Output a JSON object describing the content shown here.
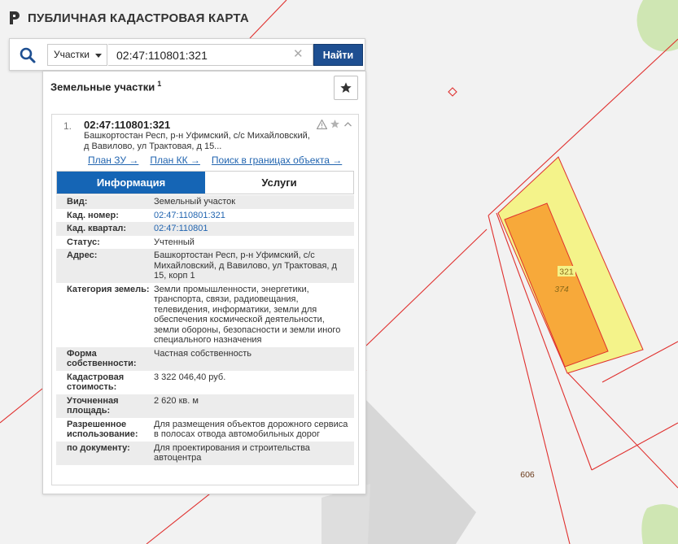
{
  "app": {
    "title": "ПУБЛИЧНАЯ КАДАСТРОВАЯ КАРТА"
  },
  "search": {
    "type_label": "Участки",
    "value": "02:47:110801:321",
    "button_label": "Найти"
  },
  "panel": {
    "title": "Земельные участки",
    "count": "1",
    "result": {
      "index": "1.",
      "number": "02:47:110801:321",
      "address": "Башкортостан Респ, р-н Уфимский, с/с Михайловский, д Вавилово, ул Трактовая, д 15...",
      "links": [
        "План ЗУ →",
        "План КК →",
        "Поиск в границах объекта →"
      ]
    },
    "tabs": [
      "Информация",
      "Услуги"
    ],
    "info": [
      {
        "label": "Вид:",
        "value": "Земельный участок"
      },
      {
        "label": "Кад. номер:",
        "value": "02:47:110801:321"
      },
      {
        "label": "Кад. квартал:",
        "value": "02:47:110801"
      },
      {
        "label": "Статус:",
        "value": "Учтенный"
      },
      {
        "label": "Адрес:",
        "value": "Башкортостан Респ, р-н Уфимский, с/с Михайловский, д Вавилово, ул Трактовая, д 15, корп 1"
      },
      {
        "label": "Категория земель:",
        "value": "Земли промышленности, энергетики, транспорта, связи, радиовещания, телевидения, информатики, земли для обеспечения космической деятельности, земли обороны, безопасности и земли иного специального назначения"
      },
      {
        "label": "Форма собственности:",
        "value": "Частная собственность"
      },
      {
        "label": "Кадастровая стоимость:",
        "value": "3 322 046,40 руб."
      },
      {
        "label": "Уточненная площадь:",
        "value": "2 620 кв. м"
      },
      {
        "label": "Разрешенное использование:",
        "value": "Для размещения объектов дорожного сервиса в полосах отвода автомобильных дорог"
      },
      {
        "label": "по документу:",
        "value": "Для проектирования и строительства автоцентра"
      }
    ]
  },
  "map": {
    "parcel_labels": [
      "321",
      "374",
      "606"
    ],
    "colors": {
      "boundary": "#e0302e",
      "parcel_fill": "#f4f38a",
      "building_fill": "#f7a93a",
      "greenery": "#cfe6b3",
      "building_gray": "#d7d7d7"
    }
  }
}
